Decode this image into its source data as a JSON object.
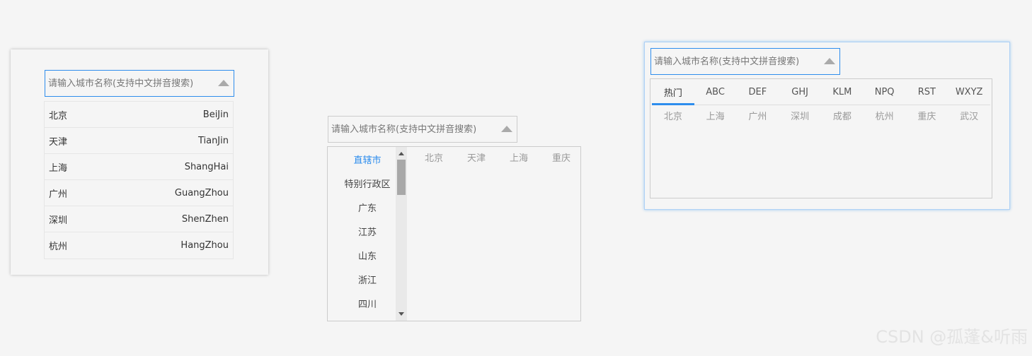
{
  "colors": {
    "background": "#f5f5f5",
    "accent": "#2e8ded",
    "border": "#cccccc",
    "muted_text": "#999999"
  },
  "panel1": {
    "search": {
      "placeholder": "请输入城市名称(支持中文拼音搜索)",
      "value": ""
    },
    "cities": [
      {
        "name": "北京",
        "pinyin": "BeiJin"
      },
      {
        "name": "天津",
        "pinyin": "TianJin"
      },
      {
        "name": "上海",
        "pinyin": "ShangHai"
      },
      {
        "name": "广州",
        "pinyin": "GuangZhou"
      },
      {
        "name": "深圳",
        "pinyin": "ShenZhen"
      },
      {
        "name": "杭州",
        "pinyin": "HangZhou"
      }
    ]
  },
  "panel2": {
    "search": {
      "placeholder": "请输入城市名称(支持中文拼音搜索)",
      "value": ""
    },
    "provinces": [
      "直辖市",
      "特别行政区",
      "广东",
      "江苏",
      "山东",
      "浙江",
      "四川"
    ],
    "active_province": "直辖市",
    "cities": [
      "北京",
      "天津",
      "上海",
      "重庆"
    ]
  },
  "panel3": {
    "search": {
      "placeholder": "请输入城市名称(支持中文拼音搜索)",
      "value": ""
    },
    "tabs": [
      "热门",
      "ABC",
      "DEF",
      "GHJ",
      "KLM",
      "NPQ",
      "RST",
      "WXYZ"
    ],
    "active_tab": "热门",
    "cities": [
      "北京",
      "上海",
      "广州",
      "深圳",
      "成都",
      "杭州",
      "重庆",
      "武汉"
    ]
  },
  "watermark": "CSDN @孤蓬&听雨",
  "icons": {
    "dropdown": "caret-up-icon",
    "scroll_up": "scroll-up-arrow-icon",
    "scroll_down": "scroll-down-arrow-icon"
  }
}
